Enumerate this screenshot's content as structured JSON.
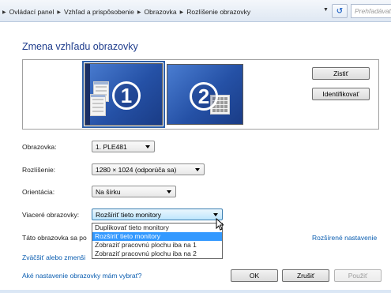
{
  "address_bar": {
    "crumbs": [
      "Ovládací panel",
      "Vzhľad a prispôsobenie",
      "Obrazovka",
      "Rozlíšenie obrazovky"
    ],
    "search_placeholder": "Prehľadávať"
  },
  "page": {
    "title": "Zmena vzhľadu obrazovky"
  },
  "monitors": {
    "monitor1_number": "1",
    "monitor2_number": "2",
    "detect_label": "Zistiť",
    "identify_label": "Identifikovať"
  },
  "form": {
    "display_label": "Obrazovka:",
    "display_value": "1. PLE481",
    "resolution_label": "Rozlíšenie:",
    "resolution_value": "1280 × 1024 (odporúča sa)",
    "orientation_label": "Orientácia:",
    "orientation_value": "Na šírku",
    "multiple_label": "Viaceré obrazovky:",
    "multiple_value": "Rozšíriť tieto monitory",
    "multiple_options": [
      "Duplikovať tieto monitory",
      "Rozšíriť tieto monitory",
      "Zobraziť pracovnú plochu iba na 1",
      "Zobraziť pracovnú plochu iba na 2"
    ],
    "main_display_text": "Táto obrazovka sa po",
    "advanced_link": "Rozšírené nastavenie"
  },
  "links": {
    "resize_text": "Zväčšiť alebo zmenši",
    "which_settings": "Aké nastavenie obrazovky mám vybrať?"
  },
  "buttons": {
    "ok": "OK",
    "cancel": "Zrušiť",
    "apply": "Použiť"
  }
}
